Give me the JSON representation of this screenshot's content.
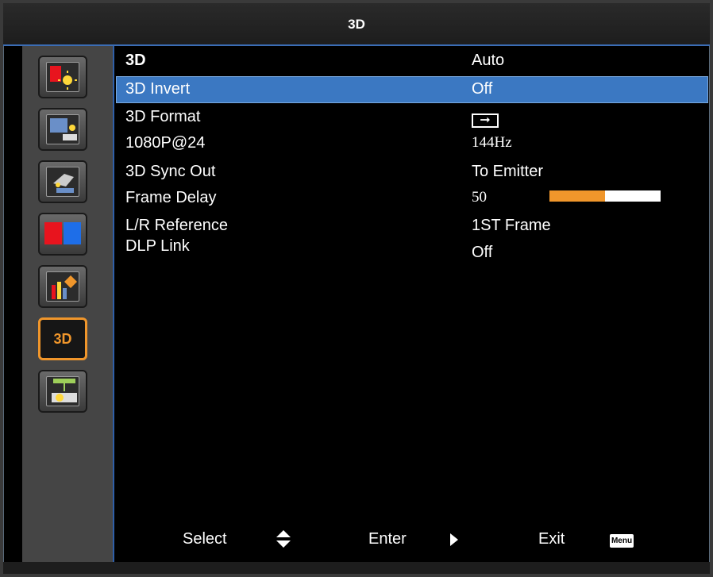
{
  "window": {
    "title": "3D"
  },
  "sidebar": {
    "items": [
      {
        "name": "image-settings",
        "icon": "image-settings-icon"
      },
      {
        "name": "display-settings",
        "icon": "display-settings-icon"
      },
      {
        "name": "setup",
        "icon": "setup-icon"
      },
      {
        "name": "color-settings",
        "icon": "color-settings-icon"
      },
      {
        "name": "info",
        "icon": "info-icon"
      },
      {
        "name": "3d",
        "icon": "3d-icon",
        "text": "3D",
        "selected": true
      },
      {
        "name": "network",
        "icon": "network-icon"
      }
    ]
  },
  "menu": {
    "header": {
      "label": "3D",
      "value": "Auto"
    },
    "rows": [
      {
        "label": "3D Invert",
        "value": "Off",
        "selected": true
      },
      {
        "label": "3D Format",
        "value_icon": "side-by-side-arrow-icon"
      },
      {
        "label": "1080P@24",
        "value": "144Hz"
      },
      {
        "label": "3D Sync Out",
        "value": "To Emitter"
      },
      {
        "label": "Frame Delay",
        "value": "50",
        "slider_fraction": 0.5
      },
      {
        "label": "L/R Reference",
        "value": "1ST Frame"
      },
      {
        "label": "DLP Link",
        "value": "Off"
      }
    ]
  },
  "footer": {
    "select_label": "Select",
    "enter_label": "Enter",
    "exit_label": "Exit",
    "menu_key": "Menu"
  },
  "colors": {
    "accent_orange": "#f0962b",
    "selection_blue": "#3b78c2",
    "background": "#000000"
  }
}
